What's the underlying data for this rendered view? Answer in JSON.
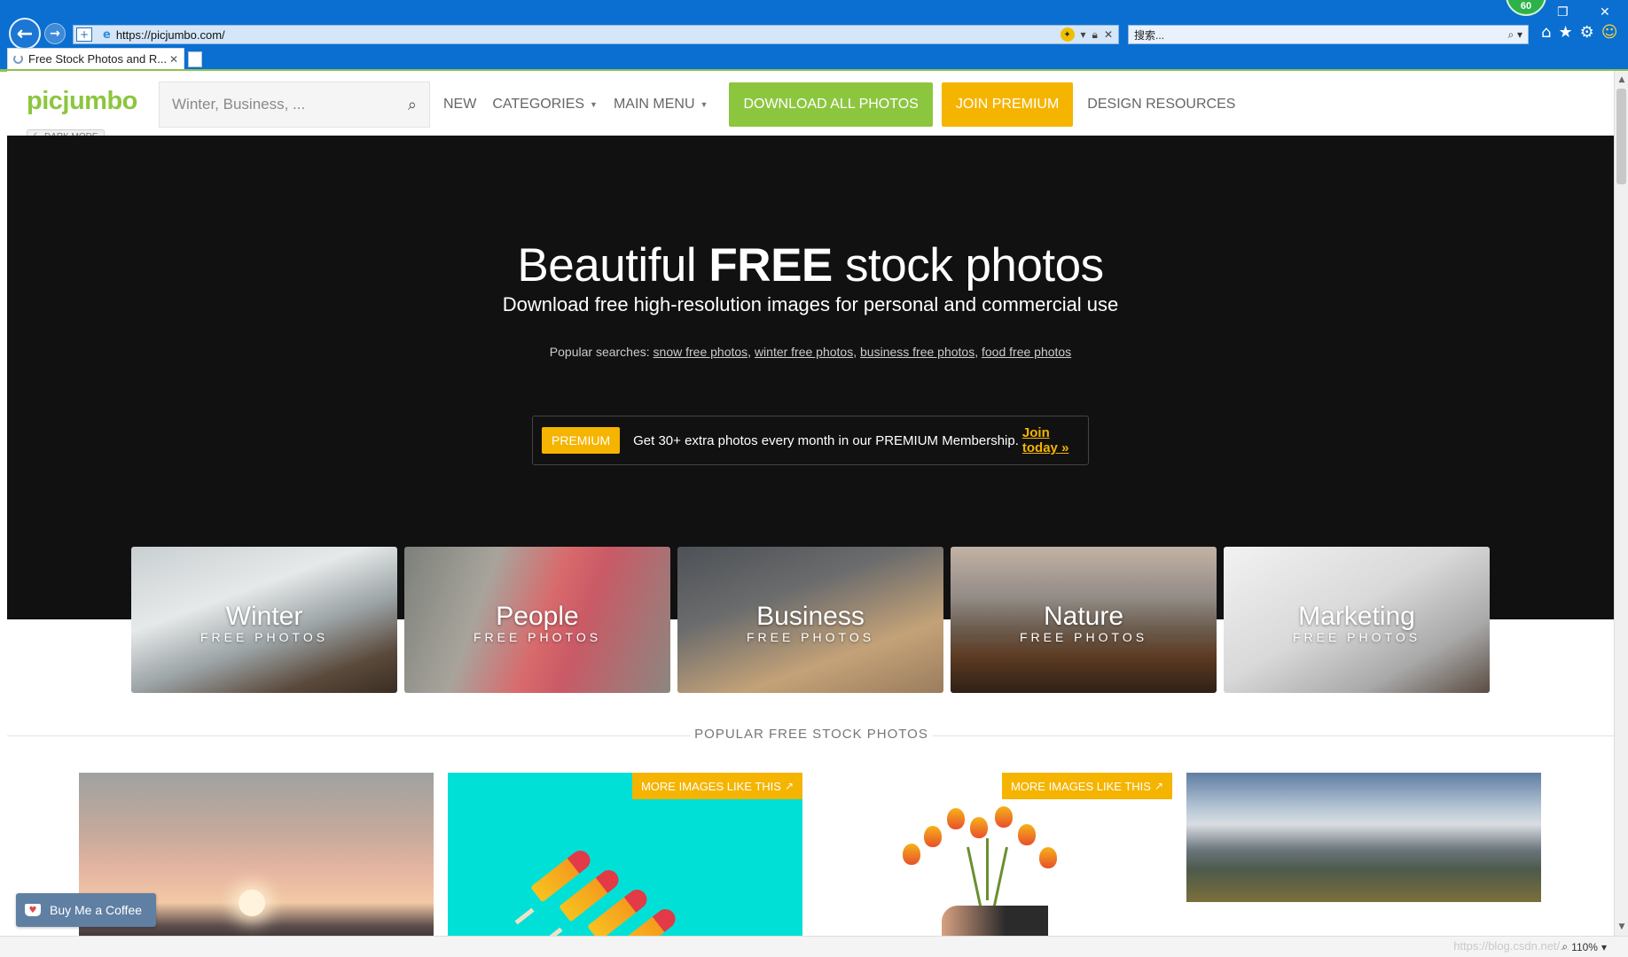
{
  "browser": {
    "url": "https://picjumbo.com/",
    "search_placeholder": "搜索...",
    "tab_title": "Free Stock Photos and R...",
    "counter": "60",
    "zoom": "110%",
    "watermark": "https://blog.csdn.net/...",
    "icons": [
      "back-icon",
      "forward-icon",
      "shield-icon",
      "ie-icon",
      "lock-icon",
      "close-icon",
      "search-icon",
      "home-icon",
      "star-icon",
      "gear-icon",
      "smiley-icon"
    ]
  },
  "header": {
    "logo": "picjumbo",
    "search_placeholder": "Winter, Business, ...",
    "nav": {
      "new": "NEW",
      "categories": "CATEGORIES",
      "main_menu": "MAIN MENU",
      "download_all": "DOWNLOAD ALL PHOTOS",
      "join_premium": "JOIN PREMIUM",
      "design_resources": "DESIGN RESOURCES"
    },
    "dark_mode": "DARK MODE"
  },
  "hero": {
    "title_pre": "Beautiful",
    "title_bold": "FREE",
    "title_post": "stock photos",
    "subtitle": "Download free high-resolution images for personal and commercial use",
    "popular_label": "Popular searches:",
    "popular": [
      "snow free photos",
      "winter free photos",
      "business free photos",
      "food free photos"
    ],
    "promo_badge": "PREMIUM",
    "promo_text": "Get 30+ extra photos every month in our PREMIUM Membership.",
    "promo_link": "Join today »"
  },
  "categories": [
    {
      "title": "Winter",
      "sub": "FREE PHOTOS"
    },
    {
      "title": "People",
      "sub": "FREE PHOTOS"
    },
    {
      "title": "Business",
      "sub": "FREE PHOTOS"
    },
    {
      "title": "Nature",
      "sub": "FREE PHOTOS"
    },
    {
      "title": "Marketing",
      "sub": "FREE PHOTOS"
    }
  ],
  "popular_section": {
    "title": "POPULAR FREE STOCK PHOTOS",
    "more_label": "MORE IMAGES LIKE THIS"
  },
  "coffee": {
    "label": "Buy Me a Coffee"
  },
  "colors": {
    "brand_green": "#8cc63f",
    "premium_yellow": "#f5b400",
    "hero_bg": "#111111",
    "browser_blue": "#0a6fd1"
  }
}
